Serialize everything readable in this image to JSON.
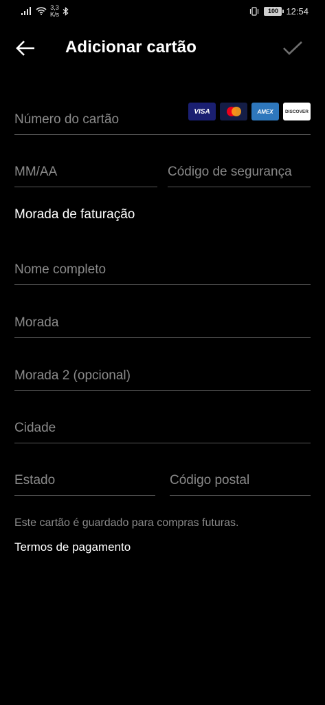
{
  "status_bar": {
    "network_speed_value": "3,3",
    "network_speed_unit": "K/s",
    "battery_level": "100",
    "time": "12:54"
  },
  "header": {
    "title": "Adicionar cartão",
    "back_icon": "arrow-left-icon",
    "confirm_icon": "check-icon"
  },
  "form": {
    "card_number_placeholder": "Número do cartão",
    "card_brands": [
      "VISA",
      "mastercard",
      "AMEX",
      "DISCOVER"
    ],
    "expiry_placeholder": "MM/AA",
    "security_code_placeholder": "Código de segurança",
    "billing_section_title": "Morada de faturação",
    "full_name_placeholder": "Nome completo",
    "address_placeholder": "Morada",
    "address2_placeholder": "Morada 2 (opcional)",
    "city_placeholder": "Cidade",
    "state_placeholder": "Estado",
    "postal_code_placeholder": "Código postal"
  },
  "footer": {
    "note": "Este cartão é guardado para compras futuras.",
    "terms_link": "Termos de pagamento"
  },
  "colors": {
    "background": "#000000",
    "text": "#ffffff",
    "placeholder": "#8a8a8a",
    "divider": "#5a5a5a"
  }
}
